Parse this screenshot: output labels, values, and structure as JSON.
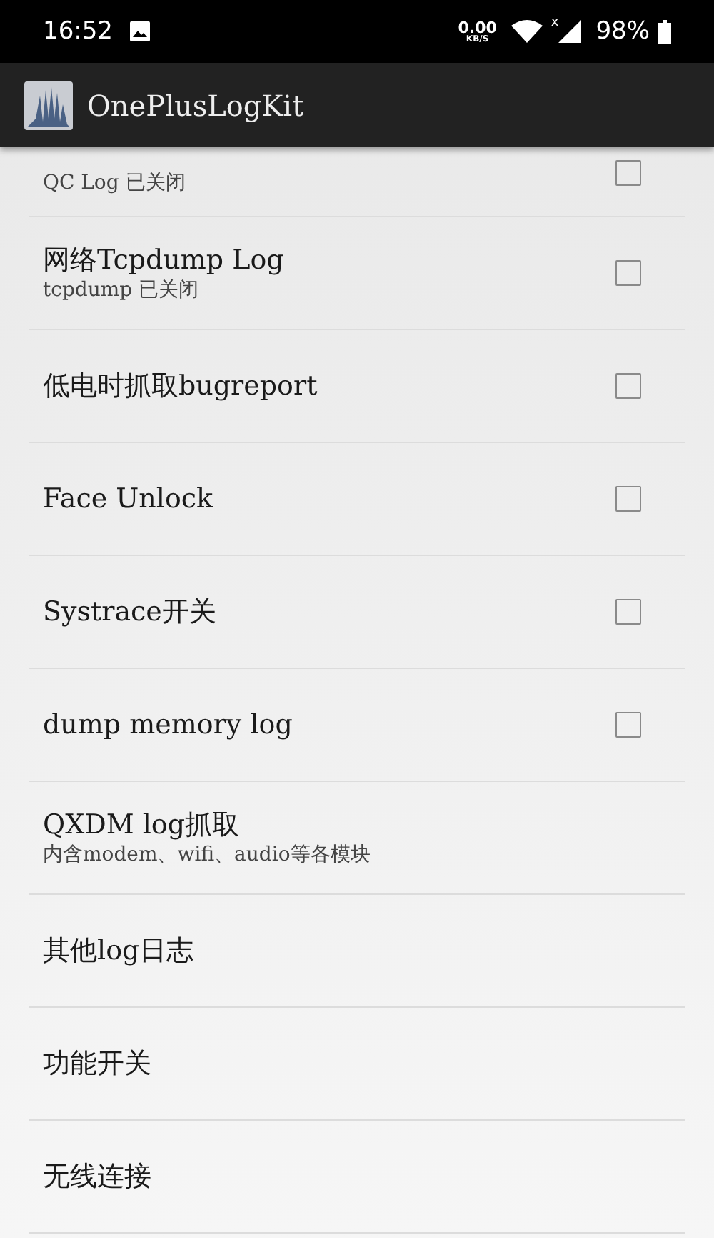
{
  "status_bar": {
    "time": "16:52",
    "speed": "0.00",
    "speed_unit": "KB/S",
    "signal_mark": "x",
    "battery": "98%"
  },
  "app_bar": {
    "title": "OnePlusLogKit"
  },
  "items": [
    {
      "kind": "checkbox",
      "subtitle": "QC Log 已关闭",
      "checked": false
    },
    {
      "kind": "checkbox",
      "title": "网络Tcpdump Log",
      "subtitle": "tcpdump 已关闭",
      "checked": false
    },
    {
      "kind": "checkbox",
      "title": "低电时抓取bugreport",
      "checked": false
    },
    {
      "kind": "checkbox",
      "title": "Face Unlock",
      "checked": false
    },
    {
      "kind": "checkbox",
      "title": "Systrace开关",
      "checked": false
    },
    {
      "kind": "checkbox",
      "title": "dump memory log",
      "checked": false
    },
    {
      "kind": "link",
      "title": "QXDM log抓取",
      "subtitle": "内含modem、wifi、audio等各模块"
    },
    {
      "kind": "link",
      "title": "其他log日志"
    },
    {
      "kind": "link",
      "title": "功能开关"
    },
    {
      "kind": "link",
      "title": "无线连接"
    }
  ]
}
